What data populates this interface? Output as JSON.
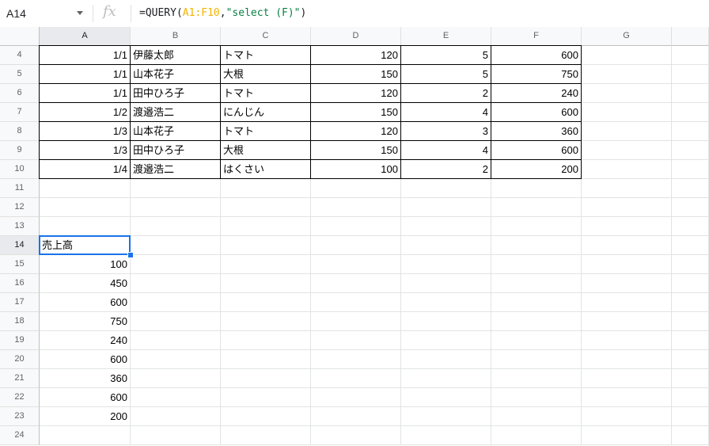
{
  "name_box": "A14",
  "fx_label": "fx",
  "formula": {
    "prefix": "=QUERY(",
    "range": "A1:F10",
    "comma": ",",
    "string": "\"select (F)\"",
    "suffix": ")"
  },
  "columns": [
    "A",
    "B",
    "C",
    "D",
    "E",
    "F",
    "G"
  ],
  "selected_column": "A",
  "selected_row": "14",
  "rows": [
    {
      "num": "4",
      "cells": [
        "1/1",
        "伊藤太郎",
        "トマト",
        "120",
        "5",
        "600"
      ]
    },
    {
      "num": "5",
      "cells": [
        "1/1",
        "山本花子",
        "大根",
        "150",
        "5",
        "750"
      ]
    },
    {
      "num": "6",
      "cells": [
        "1/1",
        "田中ひろ子",
        "トマト",
        "120",
        "2",
        "240"
      ]
    },
    {
      "num": "7",
      "cells": [
        "1/2",
        "渡邉浩二",
        "にんじん",
        "150",
        "4",
        "600"
      ]
    },
    {
      "num": "8",
      "cells": [
        "1/3",
        "山本花子",
        "トマト",
        "120",
        "3",
        "360"
      ]
    },
    {
      "num": "9",
      "cells": [
        "1/3",
        "田中ひろ子",
        "大根",
        "150",
        "4",
        "600"
      ]
    },
    {
      "num": "10",
      "cells": [
        "1/4",
        "渡邉浩二",
        "はくさい",
        "100",
        "2",
        "200"
      ]
    },
    {
      "num": "11",
      "cells": []
    },
    {
      "num": "12",
      "cells": []
    },
    {
      "num": "13",
      "cells": []
    },
    {
      "num": "14",
      "cells": [
        "売上高"
      ]
    },
    {
      "num": "15",
      "cells": [
        "100"
      ]
    },
    {
      "num": "16",
      "cells": [
        "450"
      ]
    },
    {
      "num": "17",
      "cells": [
        "600"
      ]
    },
    {
      "num": "18",
      "cells": [
        "750"
      ]
    },
    {
      "num": "19",
      "cells": [
        "240"
      ]
    },
    {
      "num": "20",
      "cells": [
        "600"
      ]
    },
    {
      "num": "21",
      "cells": [
        "360"
      ]
    },
    {
      "num": "22",
      "cells": [
        "600"
      ]
    },
    {
      "num": "23",
      "cells": [
        "200"
      ]
    },
    {
      "num": "24",
      "cells": []
    }
  ],
  "colors": {
    "accent": "#1a73e8",
    "range": "#f4b400",
    "string": "#0b8043"
  }
}
